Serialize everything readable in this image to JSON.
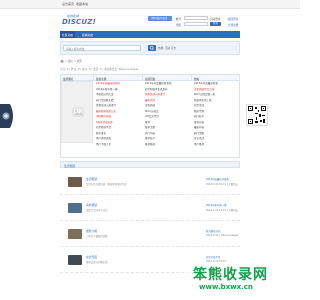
{
  "topbar": {
    "left1": "设为首页",
    "left2": "收藏本站"
  },
  "logo": {
    "mark": "DISCUZ!",
    "cn": "在线商城"
  },
  "login": {
    "qq_btn": "用QQ帐号登录",
    "user_label": "帐号",
    "auto": "自动登录",
    "pwd_label": "密码",
    "submit": "登录",
    "register": "找回密码",
    "register2": "立即注册"
  },
  "nav": {
    "items": [
      "社区动态",
      "商城动态"
    ],
    "active": 0
  },
  "search": {
    "placeholder": "请输入搜索内容",
    "hot": "热搜: 活动 官方"
  },
  "crumb": {
    "text": "> 论坛 > 社区"
  },
  "stats": {
    "text": "今日: 0 | 昨日: 0 | 帖子: 0 | 会员: 0 | 欢迎新会员: Masonsudegas"
  },
  "panel": {
    "tabs": [
      "最新图片",
      "最新主题",
      "最新回复",
      "热帖"
    ],
    "col1": [
      "2013年度最佳开发团",
      "2014年新年第一弹",
      "不能错过的大奖",
      "热门活动抢先看",
      "优惠活动火热进行",
      "最新版本更新公告",
      "中国数码商城",
      "5周年活动来袭",
      "社区开放平台",
      "助手发布",
      "用户体验调查",
      "用户下载大全"
    ],
    "col2": [
      "2013年年度最佳开发团",
      "社区新版本正式发布",
      "优惠活动火热进行",
      "最新活动",
      "全新商城",
      "MIUI 运动会",
      "QQ官方平台",
      "推荐",
      "推荐主题",
      "热门内容",
      "推荐帖子",
      "推荐版块"
    ],
    "col3": [
      "2013年年度最佳开发",
      "全新商城平台上线",
      "MIUI 运动会第一名",
      "新版本正式上线",
      "社区活动",
      "精彩专题",
      "热门帖子",
      "推荐内容",
      "最新内容",
      "热门话题",
      "官方活动",
      "用户推荐"
    ]
  },
  "forum_header": "生活频道",
  "forums": [
    {
      "title": "生活频道",
      "desc": "生活中的点滴记录，晒出你的美好生活",
      "last": "2013年度最佳开发团",
      "last2": "2014-4-10 10:19 | 大量论坛"
    },
    {
      "title": "海外频道",
      "desc": "海外生活分享与讨论",
      "last": "2014年新年第一弹",
      "last2": "2014-4-10 10:19 | 大量论坛"
    },
    {
      "title": "摄影小组",
      "desc": "一切关于摄影的话题",
      "last": "新开版块讨论",
      "last2": "2014-4-10 | Masonsudegas"
    },
    {
      "title": "交流专区",
      "desc": "版本交流与问题反馈",
      "last": "社区开放平台",
      "last2": "2014-4-10 10:19"
    }
  ],
  "watermark": {
    "title": "笨熊收录网",
    "url": "www.bxwx.cn"
  }
}
